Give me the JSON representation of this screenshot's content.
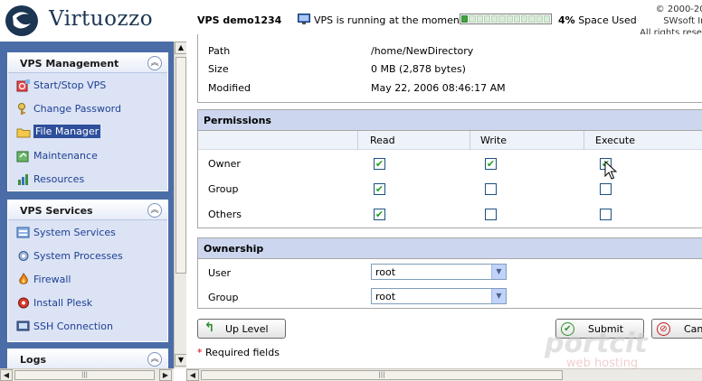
{
  "header": {
    "brand": "Virtuozzo",
    "vps_name": "VPS demo1234",
    "vps_status": "VPS is running at the moment",
    "space_percent": 4,
    "space_percent_label": "4%",
    "space_label": "Space Used",
    "copyright_lines": [
      "© 2000-200",
      "SWsoft Inc",
      "All rights reserv"
    ]
  },
  "sidebar": {
    "groups": [
      {
        "title": "VPS Management",
        "items": [
          {
            "label": "Start/Stop VPS",
            "icon": "power-icon"
          },
          {
            "label": "Change Password",
            "icon": "key-icon"
          },
          {
            "label": "File Manager",
            "icon": "folder-icon",
            "active": true
          },
          {
            "label": "Maintenance",
            "icon": "maintenance-icon"
          },
          {
            "label": "Resources",
            "icon": "resources-icon"
          }
        ]
      },
      {
        "title": "VPS Services",
        "items": [
          {
            "label": "System Services",
            "icon": "services-icon"
          },
          {
            "label": "System Processes",
            "icon": "processes-icon"
          },
          {
            "label": "Firewall",
            "icon": "firewall-icon"
          },
          {
            "label": "Install Plesk",
            "icon": "plesk-icon"
          },
          {
            "label": "SSH Connection",
            "icon": "ssh-icon"
          }
        ]
      },
      {
        "title": "Logs",
        "items": []
      }
    ]
  },
  "properties": [
    {
      "key": "Path",
      "value": "/home/NewDirectory"
    },
    {
      "key": "Size",
      "value": "0 MB  (2,878 bytes)"
    },
    {
      "key": "Modified",
      "value": "May 22, 2006 08:46:17 AM"
    }
  ],
  "permissions": {
    "title": "Permissions",
    "columns": [
      "Read",
      "Write",
      "Execute"
    ],
    "rows": [
      {
        "label": "Owner",
        "values": [
          true,
          true,
          true
        ]
      },
      {
        "label": "Group",
        "values": [
          true,
          false,
          false
        ]
      },
      {
        "label": "Others",
        "values": [
          true,
          false,
          false
        ]
      }
    ]
  },
  "ownership": {
    "title": "Ownership",
    "user_label": "User",
    "user_value": "root",
    "group_label": "Group",
    "group_value": "root"
  },
  "buttons": {
    "up_level": "Up Level",
    "submit": "Submit",
    "cancel": "Can"
  },
  "required_fields": "Required fields",
  "required_star": "*",
  "watermark": {
    "line1": "portcit",
    "line2": "web hosting"
  },
  "colors": {
    "sidebar_bg": "#4a6da8",
    "section_head": "#ccd6ee",
    "link": "#1f3f94",
    "check": "#21a121",
    "space_fill": "#3fa33f"
  }
}
